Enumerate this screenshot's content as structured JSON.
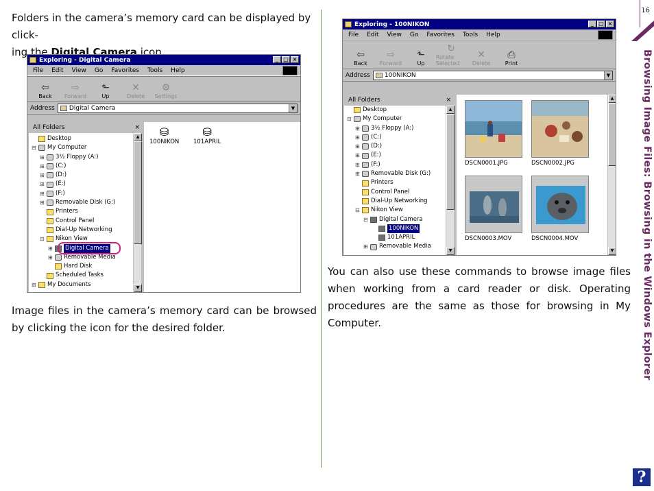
{
  "page": {
    "number": "16",
    "section_title": "Browsing Image Files: Browsing in the Windows Explorer",
    "help_label": "?"
  },
  "text": {
    "para1_a": "Folders in the camera’s memory card can be displayed by click-",
    "para1_b_pre": "ing the ",
    "para1_b_bold": "Digital Camera",
    "para1_b_post": " icon.",
    "para2": "Image files in the camera’s memory card can be browsed by clicking the icon for the desired folder.",
    "para3": "You can also use these commands to browse image files when working from a card reader or disk.  Operating procedures are the same as those for browsing in My Computer."
  },
  "window1": {
    "title": "Exploring - Digital Camera",
    "menu": [
      "File",
      "Edit",
      "View",
      "Go",
      "Favorites",
      "Tools",
      "Help"
    ],
    "toolbar": [
      {
        "label": "Back",
        "icon": "⇦",
        "enabled": true
      },
      {
        "label": "Forward",
        "icon": "⇨",
        "enabled": false
      },
      {
        "label": "Up",
        "icon": "⬑",
        "enabled": true
      },
      {
        "label": "Delete",
        "icon": "✕",
        "enabled": false
      },
      {
        "label": "Settings",
        "icon": "⚙",
        "enabled": false
      }
    ],
    "address_label": "Address",
    "address_value": "Digital Camera",
    "folders_header": "All Folders",
    "tree": [
      {
        "label": "Desktop",
        "pm": "",
        "indent": 0,
        "icon": "fold"
      },
      {
        "label": "My Computer",
        "pm": "⊟",
        "indent": 0,
        "icon": "disk"
      },
      {
        "label": "3½ Floppy (A:)",
        "pm": "⊞",
        "indent": 1,
        "icon": "disk"
      },
      {
        "label": "(C:)",
        "pm": "⊞",
        "indent": 1,
        "icon": "disk"
      },
      {
        "label": "(D:)",
        "pm": "⊞",
        "indent": 1,
        "icon": "disk"
      },
      {
        "label": "(E:)",
        "pm": "⊞",
        "indent": 1,
        "icon": "disk"
      },
      {
        "label": "(F:)",
        "pm": "⊞",
        "indent": 1,
        "icon": "disk"
      },
      {
        "label": "Removable Disk (G:)",
        "pm": "⊞",
        "indent": 1,
        "icon": "disk"
      },
      {
        "label": "Printers",
        "pm": "",
        "indent": 1,
        "icon": "fold"
      },
      {
        "label": "Control Panel",
        "pm": "",
        "indent": 1,
        "icon": "fold"
      },
      {
        "label": "Dial-Up Networking",
        "pm": "",
        "indent": 1,
        "icon": "fold"
      },
      {
        "label": "Nikon View",
        "pm": "⊟",
        "indent": 1,
        "icon": "fold"
      },
      {
        "label": "Digital Camera",
        "pm": "⊞",
        "indent": 2,
        "icon": "cam",
        "selected": true
      },
      {
        "label": "Removable Media",
        "pm": "⊞",
        "indent": 2,
        "icon": "disk"
      },
      {
        "label": "Hard Disk",
        "pm": "",
        "indent": 2,
        "icon": "fold"
      },
      {
        "label": "Scheduled Tasks",
        "pm": "",
        "indent": 1,
        "icon": "fold"
      },
      {
        "label": "My Documents",
        "pm": "⊞",
        "indent": 0,
        "icon": "fold"
      }
    ],
    "items": [
      "100NIKON",
      "101APRIL"
    ]
  },
  "window2": {
    "title": "Exploring - 100NIKON",
    "menu": [
      "File",
      "Edit",
      "View",
      "Go",
      "Favorites",
      "Tools",
      "Help"
    ],
    "toolbar": [
      {
        "label": "Back",
        "icon": "⇦",
        "enabled": true
      },
      {
        "label": "Forward",
        "icon": "⇨",
        "enabled": false
      },
      {
        "label": "Up",
        "icon": "⬑",
        "enabled": true
      },
      {
        "label": "Rotate Selected",
        "icon": "↻",
        "enabled": false
      },
      {
        "label": "Delete",
        "icon": "✕",
        "enabled": false
      },
      {
        "label": "Print",
        "icon": "⎙",
        "enabled": true
      }
    ],
    "address_label": "Address",
    "address_value": "100NIKON",
    "folders_header": "All Folders",
    "tree": [
      {
        "label": "Desktop",
        "pm": "",
        "indent": 0,
        "icon": "fold"
      },
      {
        "label": "My Computer",
        "pm": "⊟",
        "indent": 0,
        "icon": "disk"
      },
      {
        "label": "3½ Floppy (A:)",
        "pm": "⊞",
        "indent": 1,
        "icon": "disk"
      },
      {
        "label": "(C:)",
        "pm": "⊞",
        "indent": 1,
        "icon": "disk"
      },
      {
        "label": "(D:)",
        "pm": "⊞",
        "indent": 1,
        "icon": "disk"
      },
      {
        "label": "(E:)",
        "pm": "⊞",
        "indent": 1,
        "icon": "disk"
      },
      {
        "label": "(F:)",
        "pm": "⊞",
        "indent": 1,
        "icon": "disk"
      },
      {
        "label": "Removable Disk (G:)",
        "pm": "⊞",
        "indent": 1,
        "icon": "disk"
      },
      {
        "label": "Printers",
        "pm": "",
        "indent": 1,
        "icon": "fold"
      },
      {
        "label": "Control Panel",
        "pm": "",
        "indent": 1,
        "icon": "fold"
      },
      {
        "label": "Dial-Up Networking",
        "pm": "",
        "indent": 1,
        "icon": "fold"
      },
      {
        "label": "Nikon View",
        "pm": "⊟",
        "indent": 1,
        "icon": "fold"
      },
      {
        "label": "Digital Camera",
        "pm": "⊟",
        "indent": 2,
        "icon": "cam"
      },
      {
        "label": "100NIKON",
        "pm": "",
        "indent": 3,
        "icon": "cam",
        "selected": true
      },
      {
        "label": "101APRIL",
        "pm": "",
        "indent": 3,
        "icon": "cam"
      },
      {
        "label": "Removable Media",
        "pm": "⊞",
        "indent": 2,
        "icon": "disk"
      }
    ],
    "files": [
      "DSCN0001.JPG",
      "DSCN0002.JPG",
      "DSCN0003.MOV",
      "DSCN0004.MOV"
    ]
  }
}
